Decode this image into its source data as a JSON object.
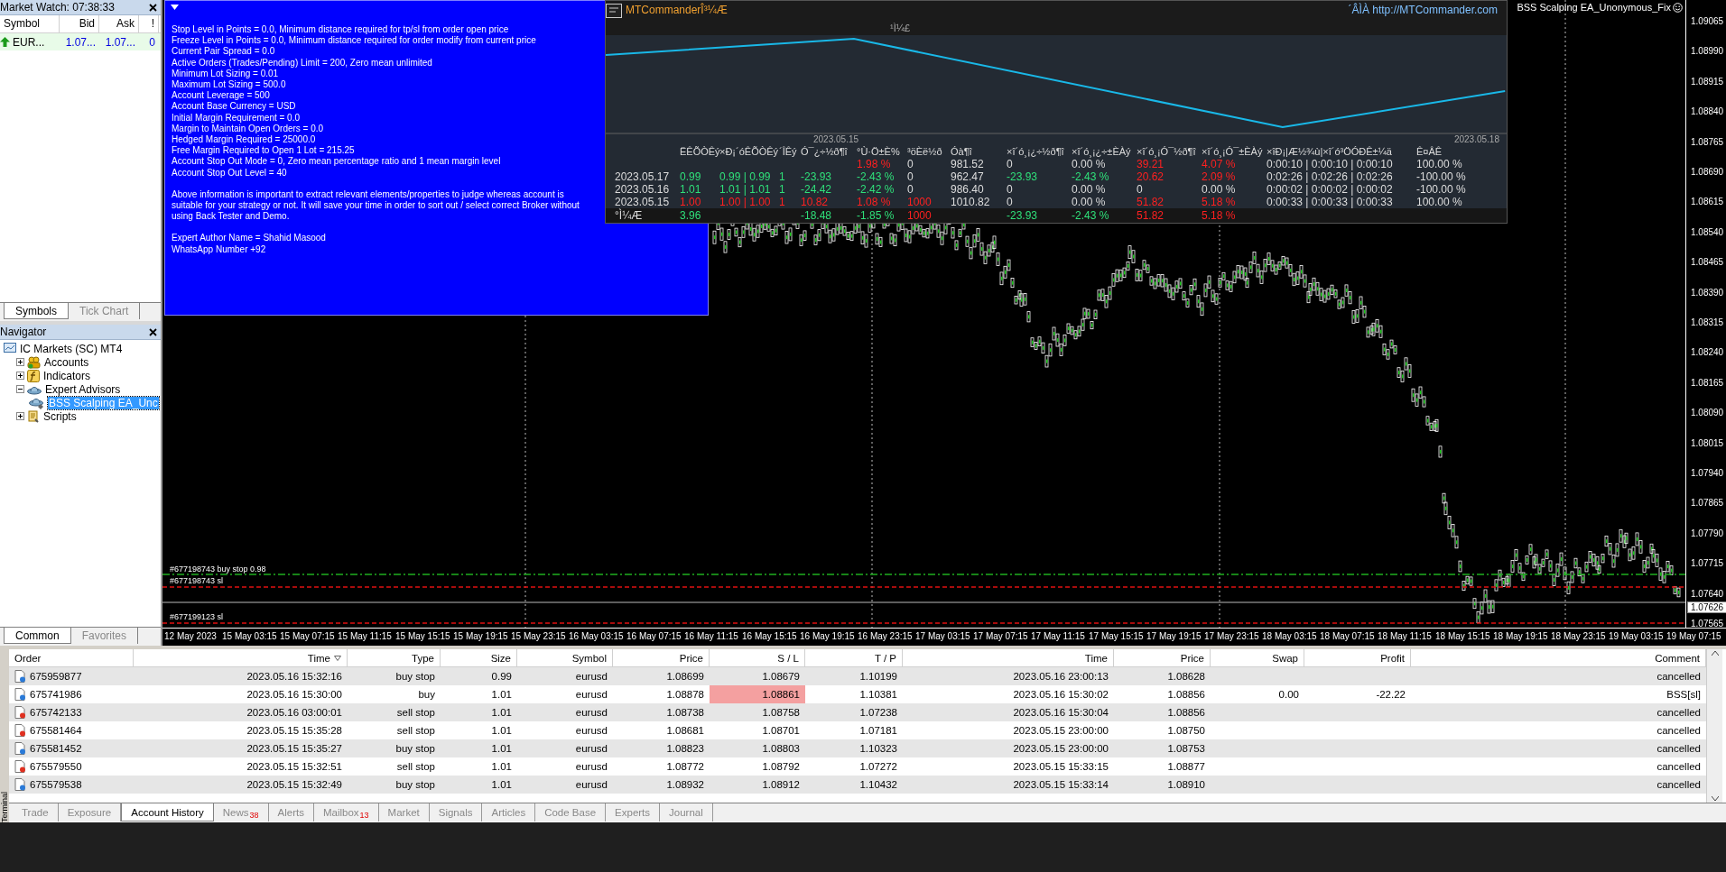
{
  "market_watch": {
    "title": "Market Watch: 07:38:33",
    "columns": [
      "Symbol",
      "Bid",
      "Ask",
      "!"
    ],
    "rows": [
      {
        "symbol": "EUR...",
        "bid": "1.07...",
        "ask": "1.07...",
        "spread": "0",
        "rising": true
      }
    ],
    "tabs": [
      {
        "label": "Symbols",
        "selected": true
      },
      {
        "label": "Tick Chart",
        "selected": false
      }
    ]
  },
  "navigator": {
    "title": "Navigator",
    "tree": {
      "label": "IC Markets (SC) MT4",
      "kind": "terminal",
      "selected": false,
      "children": [
        {
          "label": "Accounts",
          "kind": "accounts",
          "expanded": false,
          "selected": false
        },
        {
          "label": "Indicators",
          "kind": "indicators",
          "expanded": false,
          "selected": false
        },
        {
          "label": "Expert Advisors",
          "kind": "experts",
          "expanded": true,
          "selected": false,
          "children": [
            {
              "label": "BSS Scalping EA_Unc",
              "kind": "expert",
              "selected": true
            }
          ]
        },
        {
          "label": "Scripts",
          "kind": "scripts",
          "expanded": false,
          "selected": false
        }
      ]
    },
    "tabs": [
      {
        "label": "Common",
        "selected": true
      },
      {
        "label": "Favorites",
        "selected": false
      }
    ]
  },
  "chart": {
    "expert_label": "BSS Scalping EA_Unonymous_Fix",
    "info_lines": [
      "Stop Level in Points = 0.0, Minimum distance required for tp/sl from order open price",
      "Freeze Level in Points = 0.0, Minimum distance required for order modify from current price",
      "Current Pair Spread = 0.0",
      "Active Orders (Trades/Pending) Limit = 200, Zero mean unlimited",
      "Minimum Lot Sizing = 0.01",
      "Maximum Lot Sizing = 500.0",
      "Account Leverage = 500",
      "Account Base Currency = USD",
      "Initial Margin Requirement = 0.0",
      "Margin to Maintain Open Orders = 0.0",
      "Hedged Margin Required = 25000.0",
      "Free Margin Required to Open 1 Lot = 215.25",
      "Account Stop Out Mode = 0, Zero mean percentage ratio and 1 mean margin level",
      "Account Stop Out Level = 40"
    ],
    "notice": "Above information is important to extract relevant elements/properties to judge whereas account is suitable for your strategy or not. It will save your time in order to sort out / select correct Broker without using Back Tester and Demo.",
    "author_lines": [
      "Expert Author Name = Shahid Masood",
      "WhatsApp Number +92"
    ],
    "commander": {
      "title": "MTCommanderÎ³¼Æ",
      "caption": "¹Ì¼£",
      "link": "´ÂÌÀ http://MTCommander.com",
      "dates": [
        "2023.05.15",
        "2023.05.18"
      ],
      "headers": {
        "column_2": "ËÊÕÒÊý",
        "column_3": "×Ð¡´óÊÕÒÊý",
        "column_4": "´ÎÊý",
        "column_5": "Ó¯¿÷½ð¶î",
        "column_6": "°Ù·Ö±È%",
        "column_7": "³öÈë½ð",
        "column_8": "Óà¶î",
        "column_9": "×î´ó¸¡¿÷½ð¶î",
        "column_10": "×î´ó¸¡¿÷±ÈÀý",
        "column_11": "×î´ó¸¡Ó¯½ð¶î",
        "column_12": "×î´ó¸¡Ó¯±ÈÀý",
        "column_13": "×îÐ¡|Æ½¾ù|×î´ó³ÖÓÐÊ±¼ä",
        "column_14": "Ê¤ÂÊ"
      },
      "rows": [
        {
          "column_6": {
            "text": "1.98 %",
            "color": "#ff2020"
          },
          "column_7": {
            "text": "0"
          },
          "column_8": {
            "text": "981.52"
          },
          "column_9": {
            "text": "0"
          },
          "column_10": {
            "text": "0.00 %"
          },
          "column_11": {
            "text": "39.21",
            "color": "#ff2020"
          },
          "column_12": {
            "text": "4.07 %",
            "color": "#ff2020"
          },
          "column_13": {
            "text": "0:00:10 | 0:00:10 | 0:00:10"
          },
          "column_14": {
            "text": "100.00 %"
          }
        },
        {
          "column_1": {
            "text": "2023.05.17"
          },
          "column_2": {
            "text": "0.99",
            "color": "#2fe07a"
          },
          "column_3": {
            "text": "0.99 | 0.99",
            "color": "#2fe07a"
          },
          "column_4": {
            "text": "1",
            "color": "#2fe07a"
          },
          "column_5": {
            "text": "-23.93",
            "color": "#2fe07a"
          },
          "column_6": {
            "text": "-2.43 %",
            "color": "#2fe07a"
          },
          "column_7": {
            "text": "0"
          },
          "column_8": {
            "text": "962.47"
          },
          "column_9": {
            "text": "-23.93",
            "color": "#2fe07a"
          },
          "column_10": {
            "text": "-2.43 %",
            "color": "#2fe07a"
          },
          "column_11": {
            "text": "20.62",
            "color": "#ff2020"
          },
          "column_12": {
            "text": "2.09 %",
            "color": "#ff2020"
          },
          "column_13": {
            "text": "0:02:26 | 0:02:26 | 0:02:26"
          },
          "column_14": {
            "text": "-100.00 %"
          }
        },
        {
          "column_1": {
            "text": "2023.05.16"
          },
          "column_2": {
            "text": "1.01",
            "color": "#2fe07a"
          },
          "column_3": {
            "text": "1.01 | 1.01",
            "color": "#2fe07a"
          },
          "column_4": {
            "text": "1",
            "color": "#2fe07a"
          },
          "column_5": {
            "text": "-24.42",
            "color": "#2fe07a"
          },
          "column_6": {
            "text": "-2.42 %",
            "color": "#2fe07a"
          },
          "column_7": {
            "text": "0"
          },
          "column_8": {
            "text": "986.40"
          },
          "column_9": {
            "text": "0"
          },
          "column_10": {
            "text": "0.00 %"
          },
          "column_11": {
            "text": "0"
          },
          "column_12": {
            "text": "0.00 %"
          },
          "column_13": {
            "text": "0:00:02 | 0:00:02 | 0:00:02"
          },
          "column_14": {
            "text": "-100.00 %"
          }
        },
        {
          "column_1": {
            "text": "2023.05.15"
          },
          "column_2": {
            "text": "1.00",
            "color": "#ff2020"
          },
          "column_3": {
            "text": "1.00 | 1.00",
            "color": "#ff2020"
          },
          "column_4": {
            "text": "1",
            "color": "#ff2020"
          },
          "column_5": {
            "text": "10.82",
            "color": "#ff2020"
          },
          "column_6": {
            "text": "1.08 %",
            "color": "#ff2020"
          },
          "column_7": {
            "text": "1000",
            "color": "#ff2020"
          },
          "column_8": {
            "text": "1010.82"
          },
          "column_9": {
            "text": "0"
          },
          "column_10": {
            "text": "0.00 %"
          },
          "column_11": {
            "text": "51.82",
            "color": "#ff2020"
          },
          "column_12": {
            "text": "5.18 %",
            "color": "#ff2020"
          },
          "column_13": {
            "text": "0:00:33 | 0:00:33 | 0:00:33"
          },
          "column_14": {
            "text": "100.00 %"
          }
        }
      ],
      "total": {
        "column_1": {
          "text": "°Ì¼Æ"
        },
        "column_2": {
          "text": "3.96",
          "color": "#2fe07a"
        },
        "column_5": {
          "text": "-18.48",
          "color": "#2fe07a"
        },
        "column_6": {
          "text": "-1.85 %",
          "color": "#2fe07a"
        },
        "column_7": {
          "text": "1000",
          "color": "#ff2020"
        },
        "column_9": {
          "text": "-23.93",
          "color": "#2fe07a"
        },
        "column_10": {
          "text": "-2.43 %",
          "color": "#2fe07a"
        },
        "column_11": {
          "text": "51.82",
          "color": "#ff2020"
        },
        "column_12": {
          "text": "5.18 %",
          "color": "#ff2020"
        }
      }
    },
    "order_lines": [
      {
        "label": "#677198743 buy stop 0.98",
        "kind": "entry"
      },
      {
        "label": "#677198743 sl",
        "kind": "stop"
      },
      {
        "label": "#677199123 sl",
        "kind": "stop"
      }
    ],
    "price_axis": [
      "1.09065",
      "1.08990",
      "1.08915",
      "1.08840",
      "1.08765",
      "1.08690",
      "1.08615",
      "1.08540",
      "1.08465",
      "1.08390",
      "1.08315",
      "1.08240",
      "1.08165",
      "1.08090",
      "1.08015",
      "1.07940",
      "1.07865",
      "1.07790",
      "1.07715",
      "1.07640",
      "1.07565"
    ],
    "current_price": "1.07626",
    "time_axis": [
      "12 May 2023",
      "15 May 03:15",
      "15 May 07:15",
      "15 May 11:15",
      "15 May 15:15",
      "15 May 19:15",
      "15 May 23:15",
      "16 May 03:15",
      "16 May 07:15",
      "16 May 11:15",
      "16 May 15:15",
      "16 May 19:15",
      "16 May 23:15",
      "17 May 03:15",
      "17 May 07:15",
      "17 May 11:15",
      "17 May 15:15",
      "17 May 19:15",
      "17 May 23:15",
      "18 May 03:15",
      "18 May 07:15",
      "18 May 11:15",
      "18 May 15:15",
      "18 May 19:15",
      "18 May 23:15",
      "19 May 03:15",
      "19 May 07:15"
    ]
  },
  "terminal": {
    "side_label": "Terminal",
    "columns": [
      {
        "label": "Order",
        "sorted": false
      },
      {
        "label": "Time",
        "sorted": true
      },
      {
        "label": "Type",
        "sorted": false
      },
      {
        "label": "Size",
        "sorted": false
      },
      {
        "label": "Symbol",
        "sorted": false
      },
      {
        "label": "Price",
        "sorted": false
      },
      {
        "label": "S / L",
        "sorted": false
      },
      {
        "label": "T / P",
        "sorted": false
      },
      {
        "label": "Time",
        "sorted": false
      },
      {
        "label": "Price",
        "sorted": false
      },
      {
        "label": "Swap",
        "sorted": false
      },
      {
        "label": "Profit",
        "sorted": false
      },
      {
        "label": "Comment",
        "sorted": false
      }
    ],
    "rows": [
      {
        "kind": "buy",
        "sl_hit": false,
        "cells": [
          "675959877",
          "2023.05.16 15:32:16",
          "buy stop",
          "0.99",
          "eurusd",
          "1.08699",
          "1.08679",
          "1.10199",
          "2023.05.16 23:00:13",
          "1.08628",
          null,
          null,
          "cancelled"
        ]
      },
      {
        "kind": "buy",
        "sl_hit": true,
        "cells": [
          "675741986",
          "2023.05.16 15:30:00",
          "buy",
          "1.01",
          "eurusd",
          "1.08878",
          "1.08861",
          "1.10381",
          "2023.05.16 15:30:02",
          "1.08856",
          "0.00",
          "-22.22",
          "BSS[sl]"
        ]
      },
      {
        "kind": "sell",
        "sl_hit": false,
        "cells": [
          "675742133",
          "2023.05.16 03:00:01",
          "sell stop",
          "1.01",
          "eurusd",
          "1.08738",
          "1.08758",
          "1.07238",
          "2023.05.16 15:30:04",
          "1.08856",
          null,
          null,
          "cancelled"
        ]
      },
      {
        "kind": "sell",
        "sl_hit": false,
        "cells": [
          "675581464",
          "2023.05.15 15:35:28",
          "sell stop",
          "1.01",
          "eurusd",
          "1.08681",
          "1.08701",
          "1.07181",
          "2023.05.15 23:00:00",
          "1.08750",
          null,
          null,
          "cancelled"
        ]
      },
      {
        "kind": "buy",
        "sl_hit": false,
        "cells": [
          "675581452",
          "2023.05.15 15:35:27",
          "buy stop",
          "1.01",
          "eurusd",
          "1.08823",
          "1.08803",
          "1.10323",
          "2023.05.15 23:00:00",
          "1.08753",
          null,
          null,
          "cancelled"
        ]
      },
      {
        "kind": "sell",
        "sl_hit": false,
        "cells": [
          "675579550",
          "2023.05.15 15:32:51",
          "sell stop",
          "1.01",
          "eurusd",
          "1.08772",
          "1.08792",
          "1.07272",
          "2023.05.15 15:33:15",
          "1.08877",
          null,
          null,
          "cancelled"
        ]
      },
      {
        "kind": "buy",
        "sl_hit": false,
        "cells": [
          "675579538",
          "2023.05.15 15:32:49",
          "buy stop",
          "1.01",
          "eurusd",
          "1.08932",
          "1.08912",
          "1.10432",
          "2023.05.15 15:33:14",
          "1.08910",
          null,
          null,
          "cancelled"
        ]
      }
    ],
    "tabs": [
      {
        "label": "Trade",
        "selected": false
      },
      {
        "label": "Exposure",
        "selected": false
      },
      {
        "label": "Account History",
        "selected": true
      },
      {
        "label": "News",
        "badge": "38",
        "selected": false
      },
      {
        "label": "Alerts",
        "selected": false
      },
      {
        "label": "Mailbox",
        "badge": "13",
        "selected": false
      },
      {
        "label": "Market",
        "selected": false
      },
      {
        "label": "Signals",
        "selected": false
      },
      {
        "label": "Articles",
        "selected": false
      },
      {
        "label": "Code Base",
        "selected": false
      },
      {
        "label": "Experts",
        "selected": false
      },
      {
        "label": "Journal",
        "selected": false
      }
    ]
  }
}
